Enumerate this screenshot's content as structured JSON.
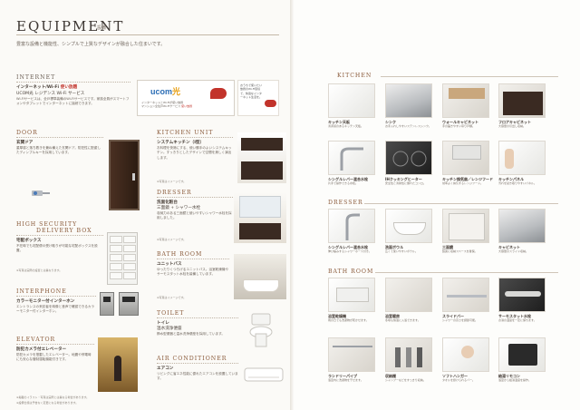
{
  "header": {
    "title": "EQUIPMENT",
    "title_sub": "設備",
    "lead": "豊富な設備と機能性、シンプルで上質なデザインが融合した住まいです。"
  },
  "left": {
    "internet": {
      "heading": "INTERNET",
      "subheading_prefix": "インターネット/Wi-Fi",
      "subheading_red": "使い放題",
      "subheading2": "UCOM光 レジデンス Wi-Fi サービス",
      "text": "Wi-Fiサービスは、全戸標準装備のWi-Fiサービスです。家族全員がスマートフォンやタブレットでインターネットに接続できます。",
      "ucom_logo": "ucom",
      "ucom_logo_y": "光",
      "ucom_note_line1": "インターネットとWi-Fiが使い放題",
      "ucom_note_line2": "マンション全住戸Wi-Fiサービス",
      "ucom_note_red": "使い放題",
      "wifi_badge": "Wi-Fi",
      "wifi_bubble": "おうちで使いたい放題のWi-Fi環境で、快適なインターネット生活を。"
    },
    "door": {
      "heading": "DOOR",
      "subheading": "玄関ドア",
      "text": "重厚感と落ち着きを兼ね備えた玄関ドア。防犯性に配慮したディンプルキーを採用しています。"
    },
    "security": {
      "heading1": "HIGH SECURITY",
      "heading2": "DELIVERY BOX",
      "subheading": "宅配ボックス",
      "text": "不在時でも宅配便の受け取りが可能な宅配ボックスを設置。",
      "note": "※写真は実際の設置とは異なります。"
    },
    "interphone": {
      "heading": "INTERPHONE",
      "subheading": "カラーモニター付インターホン",
      "text": "エントランスの来訪者を映像と音声で確認できるカラーモニター付インターホン。"
    },
    "elevator": {
      "heading": "ELEVATOR",
      "subheading": "防犯カメラ付エレベーター",
      "text": "防犯カメラを搭載したエレベーター。地震や停電時にも安心な管制運転機能付きです。"
    },
    "footnote1": "※掲載のイラスト・写真は実際とは異なる場合があります。",
    "footnote2": "※設備仕様は予告なく変更になる場合があります。"
  },
  "middle": {
    "kitchen_unit": {
      "heading": "KITCHEN UNIT",
      "subheading": "システムキッチン（I型）",
      "text": "お料理を快適にする、使い勝手のよいシステムキッチン。すっきりとしたデザインで空間を美しく演出します。",
      "note": "※写真はイメージです。"
    },
    "dresser": {
      "heading": "DRESSER",
      "subheading": "洗面化粧台",
      "subheading2": "三面鏡 + シャワー水栓",
      "text": "収納力のある三面鏡と使いやすいシャワー水栓を採用しました。",
      "note": "※写真はイメージです。"
    },
    "bathroom": {
      "heading": "BATH ROOM",
      "subheading": "ユニットバス",
      "text": "ゆったりくつろげるユニットバス。浴室乾燥機やサーモスタット水栓を装備しています。",
      "note": "※写真はイメージです。"
    },
    "toilet": {
      "heading": "TOILET",
      "subheading": "トイレ",
      "subheading2": "温水洗浄便座",
      "text": "節水型便器と温水洗浄便座を採用しています。"
    },
    "air_conditioner": {
      "heading": "AIR CONDITIONER",
      "subheading": "エアコン",
      "text": "リビングに省エネ性能に優れたエアコンを設置しています。"
    }
  },
  "right": {
    "kitchen": {
      "heading": "KITCHEN",
      "items": [
        {
          "caption": "キッチン天板",
          "text": "清潔感のあるキッチン天板。"
        },
        {
          "caption": "シンク",
          "text": "お手入れしやすいステンレスシンク。"
        },
        {
          "caption": "ウォールキャビネット",
          "text": "手の届きやすい吊り戸棚。"
        },
        {
          "caption": "フロアキャビネット",
          "text": "大容量の引出し収納。"
        },
        {
          "caption": "シングルレバー混合水栓",
          "text": "片手で操作できる水栓。"
        },
        {
          "caption": "IHクッキングヒーター",
          "text": "安全性と清掃性に優れたコンロ。"
        },
        {
          "caption": "キッチン換気扇／レンジフード",
          "text": "効率よく換気するレンジフード。"
        },
        {
          "caption": "キッチンパネル",
          "text": "汚れを拭き取りやすいパネル。"
        }
      ]
    },
    "dresser": {
      "heading": "DRESSER",
      "items": [
        {
          "caption": "シングルレバー混合水栓",
          "text": "伸び縮みするシャワーホース付き。"
        },
        {
          "caption": "洗面ボウル",
          "text": "広くて使いやすいボウル。"
        },
        {
          "caption": "三面鏡",
          "text": "鏡裏に収納スペースを確保。"
        },
        {
          "caption": "キャビネット",
          "text": "大容量のスライド収納。"
        }
      ]
    },
    "bathroom": {
      "heading": "BATH ROOM",
      "items": [
        {
          "caption": "浴室乾燥機",
          "text": "雨の日でも洗濯物が乾かせます。"
        },
        {
          "caption": "浴室暖房",
          "text": "冬場も快適に入浴できます。"
        },
        {
          "caption": "スライドバー",
          "text": "シャワーの高さを調節可能。"
        },
        {
          "caption": "サーモスタット水栓",
          "text": "お湯の温度を一定に保ちます。"
        },
        {
          "caption": "ランドリーパイプ",
          "text": "浴室内に洗濯物を干せます。"
        },
        {
          "caption": "収納棚",
          "text": "シャンプーなどをすっきり収納。"
        },
        {
          "caption": "ソフトハンガー",
          "text": "タオルを掛けられるバー。"
        },
        {
          "caption": "給湯リモコン",
          "text": "浴室から給湯温度を操作。"
        }
      ]
    }
  },
  "colors": {
    "accent_brown": "#8a5a3a",
    "red": "#c2332b",
    "ucom_blue": "#2b6db5"
  }
}
